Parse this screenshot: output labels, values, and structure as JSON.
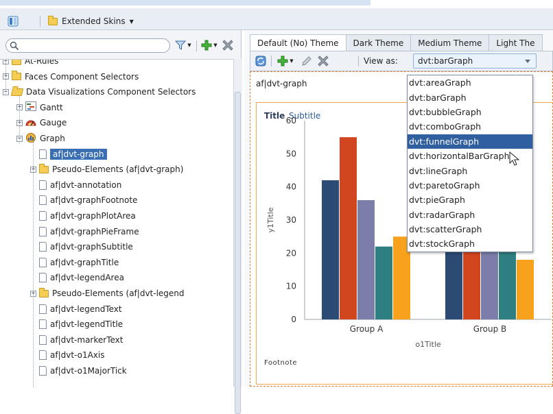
{
  "toolbar": {
    "skins_label": "Extended Skins",
    "icons": [
      "panel-toggle-icon",
      "folder-icon",
      "chevron-down-icon"
    ]
  },
  "left_panel": {
    "search_placeholder": "",
    "icons": [
      "search-icon",
      "filter-icon",
      "add-icon",
      "delete-icon"
    ],
    "tree": [
      {
        "label": "At-Rules",
        "depth": 0,
        "type": "folder",
        "expander": "+"
      },
      {
        "label": "Faces Component Selectors",
        "depth": 0,
        "type": "folder",
        "expander": "+"
      },
      {
        "label": "Data Visualizations Component Selectors",
        "depth": 0,
        "type": "folder-open",
        "expander": "−"
      },
      {
        "label": "Gantt",
        "depth": 1,
        "type": "gantt",
        "expander": "+"
      },
      {
        "label": "Gauge",
        "depth": 1,
        "type": "gauge",
        "expander": "+"
      },
      {
        "label": "Graph",
        "depth": 1,
        "type": "graph",
        "expander": "−"
      },
      {
        "label": "af|dvt-graph",
        "depth": 2,
        "type": "page",
        "selected": true
      },
      {
        "label": "Pseudo-Elements (af|dvt-graph)",
        "depth": 2,
        "type": "folder",
        "expander": "+"
      },
      {
        "label": "af|dvt-annotation",
        "depth": 2,
        "type": "page"
      },
      {
        "label": "af|dvt-graphFootnote",
        "depth": 2,
        "type": "page"
      },
      {
        "label": "af|dvt-graphPlotArea",
        "depth": 2,
        "type": "page"
      },
      {
        "label": "af|dvt-graphPieFrame",
        "depth": 2,
        "type": "page"
      },
      {
        "label": "af|dvt-graphSubtitle",
        "depth": 2,
        "type": "page"
      },
      {
        "label": "af|dvt-graphTitle",
        "depth": 2,
        "type": "page"
      },
      {
        "label": "af|dvt-legendArea",
        "depth": 2,
        "type": "page"
      },
      {
        "label": "Pseudo-Elements (af|dvt-legend",
        "depth": 2,
        "type": "folder",
        "expander": "+"
      },
      {
        "label": "af|dvt-legendText",
        "depth": 2,
        "type": "page"
      },
      {
        "label": "af|dvt-legendTitle",
        "depth": 2,
        "type": "page"
      },
      {
        "label": "af|dvt-markerText",
        "depth": 2,
        "type": "page"
      },
      {
        "label": "af|dvt-o1Axis",
        "depth": 2,
        "type": "page"
      },
      {
        "label": "af|dvt-o1MajorTick",
        "depth": 2,
        "type": "page"
      }
    ]
  },
  "right_panel": {
    "tabs": [
      {
        "label": "Default (No) Theme",
        "active": true
      },
      {
        "label": "Dark Theme",
        "active": false
      },
      {
        "label": "Medium Theme",
        "active": false
      },
      {
        "label": "Light The",
        "active": false
      }
    ],
    "toolbar_icons": [
      "refresh-icon",
      "add-icon",
      "edit-icon",
      "delete-icon"
    ],
    "view_as_label": "View as:",
    "view_as_value": "dvt:barGraph",
    "preview_title": "af|dvt-graph",
    "dropdown_options": [
      {
        "label": "dvt:areaGraph",
        "highlighted": false
      },
      {
        "label": "dvt:barGraph",
        "highlighted": false
      },
      {
        "label": "dvt:bubbleGraph",
        "highlighted": false
      },
      {
        "label": "dvt:comboGraph",
        "highlighted": false
      },
      {
        "label": "dvt:funnelGraph",
        "highlighted": true
      },
      {
        "label": "dvt:horizontalBarGraph",
        "highlighted": false
      },
      {
        "label": "dvt:lineGraph",
        "highlighted": false
      },
      {
        "label": "dvt:paretoGraph",
        "highlighted": false
      },
      {
        "label": "dvt:pieGraph",
        "highlighted": false
      },
      {
        "label": "dvt:radarGraph",
        "highlighted": false
      },
      {
        "label": "dvt:scatterGraph",
        "highlighted": false
      },
      {
        "label": "dvt:stockGraph",
        "highlighted": false
      }
    ]
  },
  "chart_data": {
    "type": "bar",
    "title": "Title",
    "subtitle": "Subtitle",
    "xlabel": "o1Title",
    "ylabel": "y1Title",
    "footnote": "Footnote",
    "ylim": [
      0,
      60
    ],
    "yticks": [
      0,
      10,
      20,
      30,
      40,
      50,
      60
    ],
    "grid": false,
    "categories": [
      "Group A",
      "Group B"
    ],
    "series": [
      {
        "values": [
          42,
          30
        ],
        "color": "#2b4a74"
      },
      {
        "values": [
          55,
          30
        ],
        "color": "#d1461f"
      },
      {
        "values": [
          36,
          30
        ],
        "color": "#7a7ea8"
      },
      {
        "values": [
          22,
          30
        ],
        "color": "#2e7f82"
      },
      {
        "values": [
          25,
          18
        ],
        "color": "#f7a11c"
      }
    ]
  }
}
